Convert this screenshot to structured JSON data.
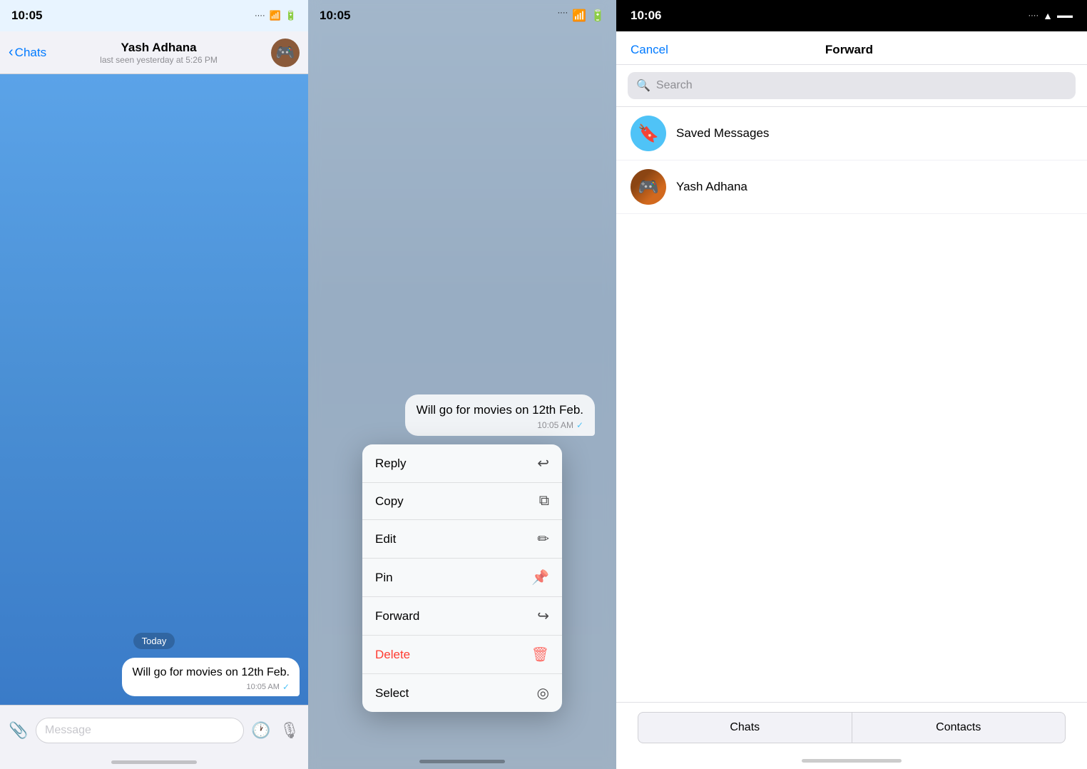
{
  "panel_chat": {
    "status_time": "10:05",
    "back_label": "Chats",
    "contact_name": "Yash Adhana",
    "contact_status": "last seen yesterday at 5:26 PM",
    "date_badge": "Today",
    "message_text": "Will go for movies on 12th Feb.",
    "message_time": "10:05 AM",
    "input_placeholder": "Message"
  },
  "panel_context": {
    "status_time": "10:05",
    "message_preview": "Will go for movies on 12th Feb.",
    "preview_time": "10:05 AM",
    "menu_items": [
      {
        "label": "Reply",
        "icon": "↩",
        "color": "normal"
      },
      {
        "label": "Copy",
        "icon": "⧉",
        "color": "normal"
      },
      {
        "label": "Edit",
        "icon": "✏",
        "color": "normal"
      },
      {
        "label": "Pin",
        "icon": "⊳",
        "color": "normal"
      },
      {
        "label": "Forward",
        "icon": "↪",
        "color": "normal"
      },
      {
        "label": "Delete",
        "icon": "🗑",
        "color": "delete"
      },
      {
        "label": "Select",
        "icon": "◎",
        "color": "normal"
      }
    ]
  },
  "panel_forward": {
    "status_time": "10:06",
    "cancel_label": "Cancel",
    "title": "Forward",
    "search_placeholder": "Search",
    "contacts": [
      {
        "name": "Saved Messages",
        "type": "saved"
      },
      {
        "name": "Yash Adhana",
        "type": "user"
      }
    ],
    "tab_chats": "Chats",
    "tab_contacts": "Contacts"
  }
}
